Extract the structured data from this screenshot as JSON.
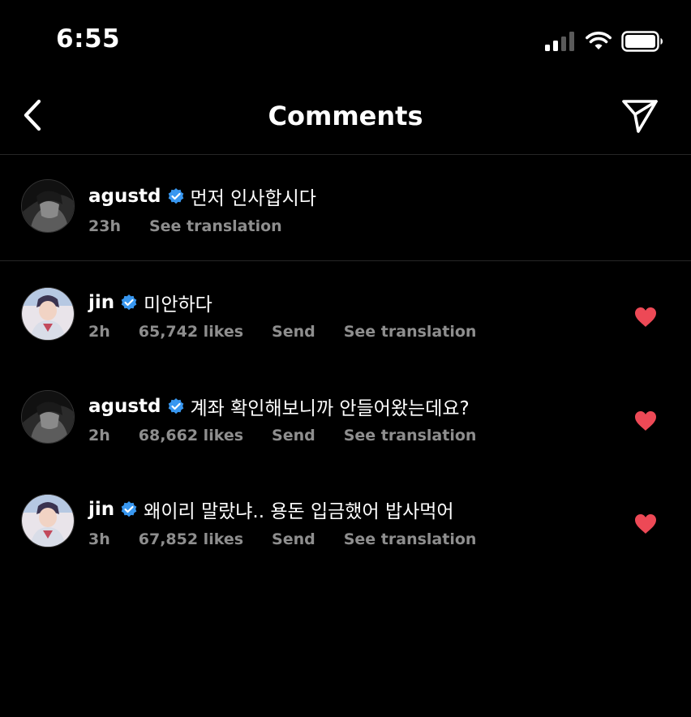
{
  "status_bar": {
    "time": "6:55",
    "icons": [
      "cellular-signal-icon",
      "wifi-icon",
      "battery-icon"
    ]
  },
  "nav": {
    "title": "Comments",
    "back_icon": "chevron-left-icon",
    "share_icon": "paper-plane-icon"
  },
  "caption": {
    "username": "agustd",
    "verified": true,
    "text": "먼저 인사합시다",
    "time": "23h",
    "translate_label": "See translation"
  },
  "comments": [
    {
      "username": "jin",
      "verified": true,
      "text": "미안하다",
      "time": "2h",
      "likes": "65,742 likes",
      "send_label": "Send",
      "translate_label": "See translation",
      "liked": true
    },
    {
      "username": "agustd",
      "verified": true,
      "text": "계좌 확인해보니까 안들어왔는데요?",
      "time": "2h",
      "likes": "68,662 likes",
      "send_label": "Send",
      "translate_label": "See translation",
      "liked": true
    },
    {
      "username": "jin",
      "verified": true,
      "text": "왜이리 말랐냐.. 용돈 입금했어 밥사먹어",
      "time": "3h",
      "likes": "67,852 likes",
      "send_label": "Send",
      "translate_label": "See translation",
      "liked": true
    }
  ],
  "colors": {
    "background": "#000000",
    "text": "#ffffff",
    "meta": "#8e8e8e",
    "verified_badge": "#3897f0",
    "heart": "#ed4956",
    "divider": "#262626"
  }
}
